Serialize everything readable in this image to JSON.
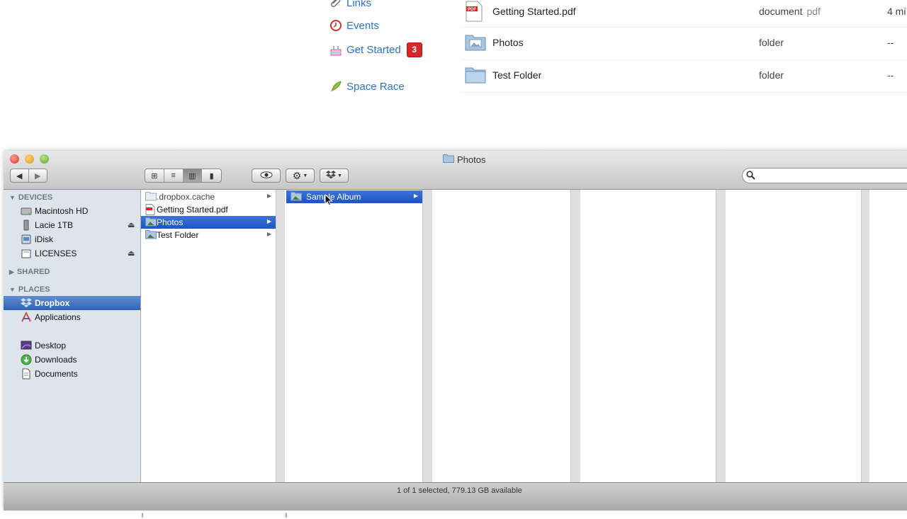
{
  "web": {
    "nav": [
      {
        "label": "Links",
        "icon": "paperclip-icon"
      },
      {
        "label": "Events",
        "icon": "clock-icon"
      },
      {
        "label": "Get Started",
        "icon": "cake-icon",
        "badge": "3"
      },
      {
        "label": "Space Race",
        "icon": "rocket-icon"
      }
    ],
    "files": [
      {
        "name": "Getting Started.pdf",
        "kind": "document",
        "ext": "pdf",
        "modified": "4 mi",
        "icon": "pdf-icon"
      },
      {
        "name": "Photos",
        "kind": "folder",
        "ext": "",
        "modified": "--",
        "icon": "photo-folder-icon"
      },
      {
        "name": "Test Folder",
        "kind": "folder",
        "ext": "",
        "modified": "--",
        "icon": "folder-icon"
      }
    ]
  },
  "finder": {
    "title": "Photos",
    "sidebar": {
      "devices_label": "DEVICES",
      "devices": [
        {
          "label": "Macintosh HD",
          "icon": "harddrive-icon",
          "eject": false
        },
        {
          "label": "Lacie 1TB",
          "icon": "external-drive-icon",
          "eject": true
        },
        {
          "label": "iDisk",
          "icon": "idisk-icon",
          "eject": false
        },
        {
          "label": "LICENSES",
          "icon": "disk-image-icon",
          "eject": true
        }
      ],
      "shared_label": "SHARED",
      "places_label": "PLACES",
      "places": [
        {
          "label": "Dropbox",
          "icon": "dropbox-icon",
          "selected": true
        },
        {
          "label": "Applications",
          "icon": "applications-icon",
          "selected": false
        },
        {
          "label": "Desktop",
          "icon": "desktop-icon",
          "selected": false
        },
        {
          "label": "Downloads",
          "icon": "downloads-icon",
          "selected": false
        },
        {
          "label": "Documents",
          "icon": "documents-icon",
          "selected": false
        }
      ]
    },
    "column1": [
      {
        "label": ".dropbox.cache",
        "icon": "folder-icon",
        "selected": false,
        "arrow": true
      },
      {
        "label": "Getting Started.pdf",
        "icon": "pdf-icon",
        "selected": false,
        "arrow": false
      },
      {
        "label": "Photos",
        "icon": "photo-folder-icon",
        "selected": true,
        "arrow": true
      },
      {
        "label": "Test Folder",
        "icon": "folder-icon",
        "selected": false,
        "arrow": true
      }
    ],
    "column2": [
      {
        "label": "Sample Album",
        "icon": "photo-folder-icon",
        "selected": true,
        "arrow": true
      }
    ],
    "status": "1 of 1 selected, 779.13 GB available"
  }
}
